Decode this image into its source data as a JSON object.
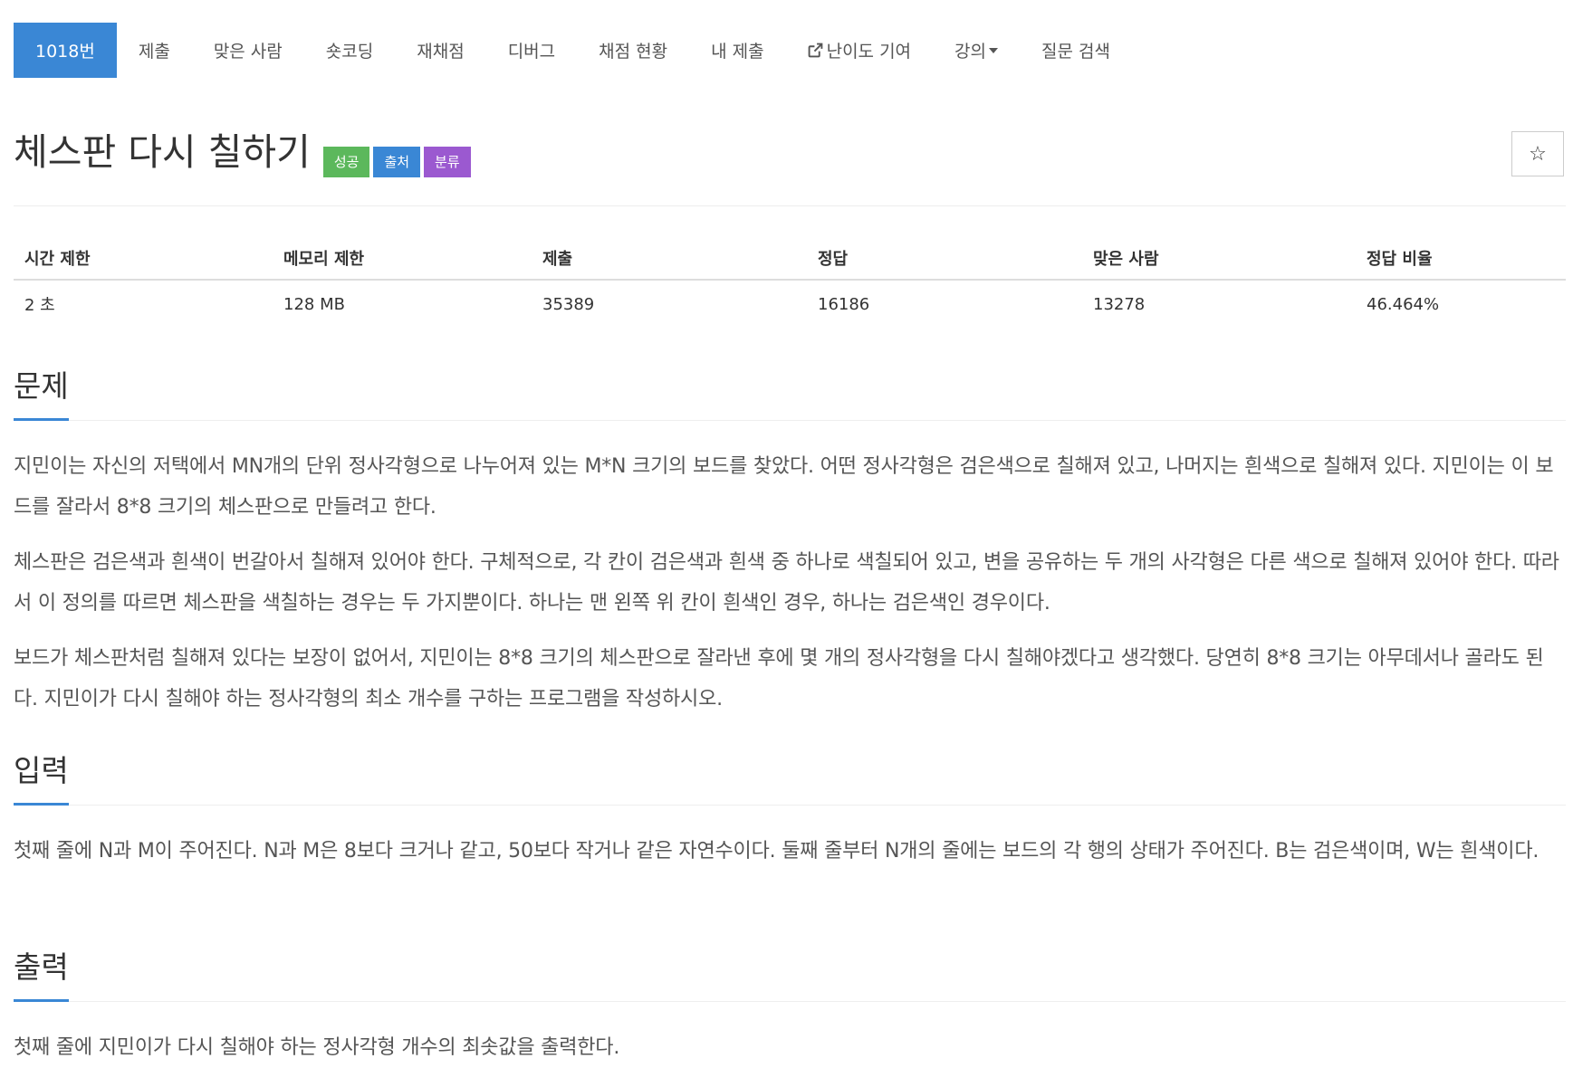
{
  "tabs": [
    {
      "label": "1018번",
      "active": true
    },
    {
      "label": "제출"
    },
    {
      "label": "맞은 사람"
    },
    {
      "label": "숏코딩"
    },
    {
      "label": "재채점"
    },
    {
      "label": "디버그"
    },
    {
      "label": "채점 현황"
    },
    {
      "label": "내 제출"
    },
    {
      "label": "난이도 기여",
      "icon": "external-link-icon"
    },
    {
      "label": "강의",
      "icon": "caret-down-icon"
    },
    {
      "label": "질문 검색"
    }
  ],
  "problem": {
    "title": "체스판 다시 칠하기",
    "badges": [
      {
        "label": "성공",
        "color": "#5cb85c"
      },
      {
        "label": "출처",
        "color": "#3a87d5"
      },
      {
        "label": "분류",
        "color": "#9b59d0"
      }
    ],
    "star_icon": "☆"
  },
  "info": {
    "headers": [
      "시간 제한",
      "메모리 제한",
      "제출",
      "정답",
      "맞은 사람",
      "정답 비율"
    ],
    "values": [
      "2 초",
      "128 MB",
      "35389",
      "16186",
      "13278",
      "46.464%"
    ]
  },
  "sections": {
    "description": {
      "title": "문제",
      "paragraphs": [
        "지민이는 자신의 저택에서 MN개의 단위 정사각형으로 나누어져 있는 M*N 크기의 보드를 찾았다. 어떤 정사각형은 검은색으로 칠해져 있고, 나머지는 흰색으로 칠해져 있다. 지민이는 이 보드를 잘라서 8*8 크기의 체스판으로 만들려고 한다.",
        "체스판은 검은색과 흰색이 번갈아서 칠해져 있어야 한다. 구체적으로, 각 칸이 검은색과 흰색 중 하나로 색칠되어 있고, 변을 공유하는 두 개의 사각형은 다른 색으로 칠해져 있어야 한다. 따라서 이 정의를 따르면 체스판을 색칠하는 경우는 두 가지뿐이다. 하나는 맨 왼쪽 위 칸이 흰색인 경우, 하나는 검은색인 경우이다.",
        "보드가 체스판처럼 칠해져 있다는 보장이 없어서, 지민이는 8*8 크기의 체스판으로 잘라낸 후에 몇 개의 정사각형을 다시 칠해야겠다고 생각했다. 당연히 8*8 크기는 아무데서나 골라도 된다. 지민이가 다시 칠해야 하는 정사각형의 최소 개수를 구하는 프로그램을 작성하시오."
      ]
    },
    "input": {
      "title": "입력",
      "paragraphs": [
        "첫째 줄에 N과 M이 주어진다. N과 M은 8보다 크거나 같고, 50보다 작거나 같은 자연수이다. 둘째 줄부터 N개의 줄에는 보드의 각 행의 상태가 주어진다. B는 검은색이며, W는 흰색이다."
      ]
    },
    "output": {
      "title": "출력",
      "paragraphs": [
        "첫째 줄에 지민이가 다시 칠해야 하는 정사각형 개수의 최솟값을 출력한다."
      ]
    }
  }
}
